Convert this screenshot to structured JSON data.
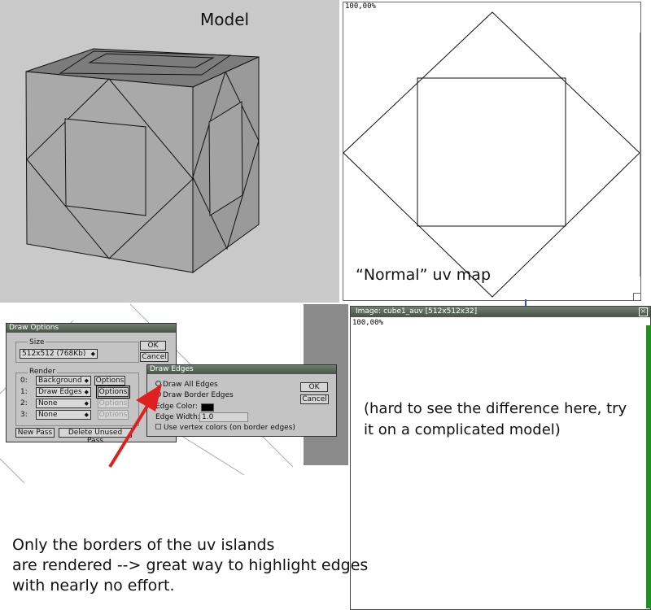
{
  "model_view": {
    "title": "Model"
  },
  "uv_view": {
    "zoom": "100,00%",
    "caption": "“Normal” uv map"
  },
  "draw_options": {
    "title": "Draw Options",
    "size_label": "Size",
    "size_value": "512x512 (768Kb)",
    "ok_label": "OK",
    "cancel_label": "Cancel",
    "render_label": "Render",
    "rows": [
      {
        "index": "0:",
        "mode": "Background",
        "options": "Options"
      },
      {
        "index": "1:",
        "mode": "Draw Edges",
        "options": "Options"
      },
      {
        "index": "2:",
        "mode": "None",
        "options": "Options"
      },
      {
        "index": "3:",
        "mode": "None",
        "options": "Options"
      }
    ],
    "new_pass_label": "New Pass",
    "delete_pass_label": "Delete Unused Pass"
  },
  "draw_edges": {
    "title": "Draw Edges",
    "option_all": "Draw All Edges",
    "option_border": "Draw Border Edges",
    "edge_color_label": "Edge Color:",
    "edge_color": "#000000",
    "edge_width_label": "Edge Width:",
    "edge_width_value": "1.0",
    "vertex_colors_label": "Use vertex colors (on border edges)",
    "ok_label": "OK",
    "cancel_label": "Cancel"
  },
  "image_window": {
    "title": "Image: cube1_auv [512x512x32]",
    "zoom": "100,00%",
    "note": "(hard to see the difference here, try it on a complicated model)"
  },
  "bottom_note": {
    "line1": "Only the borders of the uv islands",
    "line2": "are rendered --> great way to highlight edges",
    "line3": "with nearly no effort."
  },
  "colors": {
    "accent_arrow": "#e02020",
    "titlebar": "#566456",
    "dialog_bg": "#c4c4c4"
  },
  "icons": [
    "close-icon",
    "dropdown-arrow-icon",
    "radio-icon",
    "checkbox-icon",
    "red-arrow-icon"
  ]
}
